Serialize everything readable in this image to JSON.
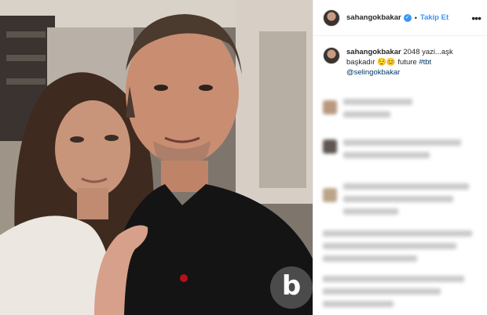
{
  "post": {
    "username": "sahangokbakar",
    "follow_label": "Takip Et",
    "separator": "•",
    "more_label": "•••",
    "caption": {
      "text": "2048 yazi...aşk başkadır",
      "emoji": "😌😊",
      "word": "future",
      "hashtag": "#tbt",
      "mention": "@selingokbakar"
    }
  },
  "watermark": {
    "letter": "b"
  },
  "colors": {
    "link_blue": "#3897f0",
    "hashtag_blue": "#003569",
    "text": "#262626"
  }
}
